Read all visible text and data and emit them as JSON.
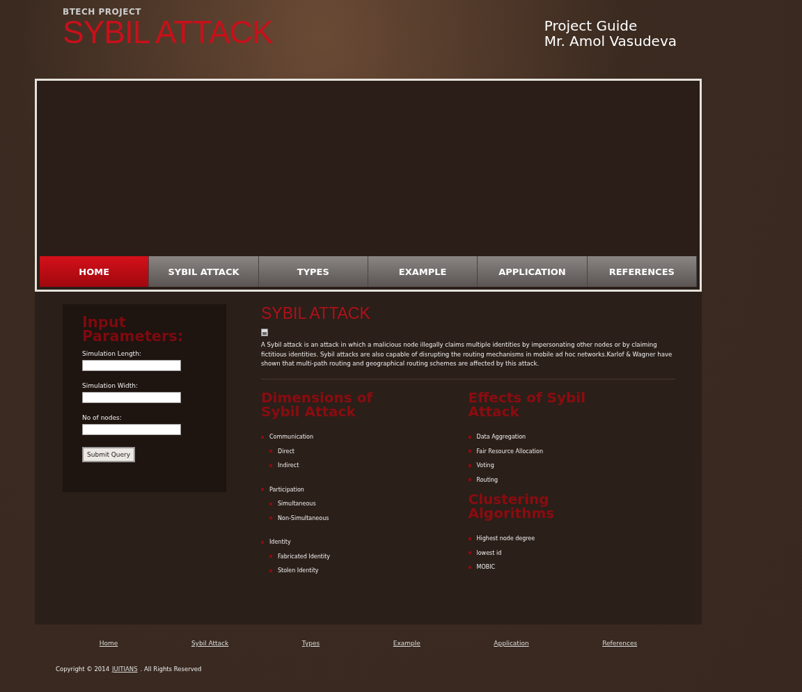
{
  "header": {
    "kicker": "BTECH PROJECT",
    "title": "SYBIL ATTACK",
    "guide_label": "Project Guide",
    "guide_name": "Mr. Amol Vasudeva"
  },
  "nav": [
    {
      "label": "HOME",
      "selected": true
    },
    {
      "label": "SYBIL ATTACK",
      "selected": false
    },
    {
      "label": "TYPES",
      "selected": false
    },
    {
      "label": "EXAMPLE",
      "selected": false
    },
    {
      "label": "APPLICATION",
      "selected": false
    },
    {
      "label": "REFERENCES",
      "selected": false
    }
  ],
  "sidebar": {
    "title": "Input Parameters:",
    "fields": [
      {
        "label": "Simulation Length:"
      },
      {
        "label": "Simulation Width:"
      },
      {
        "label": "No of nodes:"
      }
    ],
    "button": "Submit Query"
  },
  "main": {
    "title": "SYBIL ATTACK",
    "intro": "A Sybil attack is an attack in which a malicious node illegally claims multiple identities by impersonating other nodes or by claiming fictitious identities. Sybil attacks are also capable of disrupting the routing mechanisms in mobile ad hoc networks.Karlof & Wagner have shown that multi-path routing and geographical routing schemes are affected by this attack.",
    "dimensions": {
      "title": "Dimensions of Sybil Attack",
      "items": [
        {
          "label": "Communication",
          "children": [
            {
              "label": "Direct"
            },
            {
              "label": "Indirect"
            }
          ]
        },
        {
          "label": "Participation",
          "children": [
            {
              "label": "Simultaneous"
            },
            {
              "label": "Non-Simultaneous"
            }
          ]
        },
        {
          "label": "Identity",
          "children": [
            {
              "label": "Fabricated Identity"
            },
            {
              "label": "Stolen Identity"
            }
          ]
        }
      ]
    },
    "effects": {
      "title": "Effects of Sybil Attack",
      "items": [
        "Data Aggregation",
        "Fair Resource Allocation",
        "Voting",
        "Routing"
      ]
    },
    "clustering": {
      "title": "Clustering Algorithms",
      "items": [
        "Highest node degree",
        "lowest id",
        "MOBIC"
      ]
    }
  },
  "footer": {
    "links": [
      "Home",
      "Sybil Attack",
      "Types",
      "Example",
      "Application",
      "References"
    ],
    "copyright_prefix": "Copyright © 2014",
    "copyright_link": "JUITIANS",
    "copyright_suffix": ". All Rights Reserved"
  }
}
